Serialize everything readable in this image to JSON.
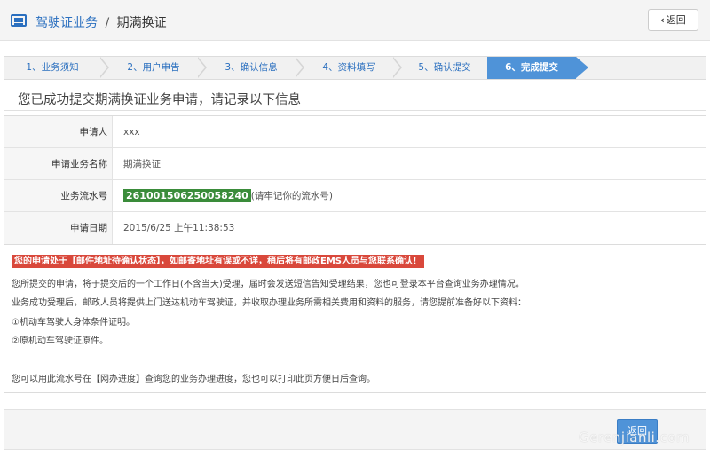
{
  "header": {
    "breadcrumb_link": "驾驶证业务",
    "breadcrumb_sep": "/",
    "breadcrumb_current": "期满换证",
    "back_label": "返回",
    "back_icon": "chevron-left-icon"
  },
  "steps": [
    {
      "label": "1、业务须知",
      "active": false
    },
    {
      "label": "2、用户申告",
      "active": false
    },
    {
      "label": "3、确认信息",
      "active": false
    },
    {
      "label": "4、资料填写",
      "active": false
    },
    {
      "label": "5、确认提交",
      "active": false
    },
    {
      "label": "6、完成提交",
      "active": true
    }
  ],
  "success_title": "您已成功提交期满换证业务申请，请记录以下信息",
  "info": [
    {
      "label": "申请人",
      "value": "xxx"
    },
    {
      "label": "申请业务名称",
      "value": "期满换证"
    },
    {
      "label": "业务流水号",
      "serial": "261001506250058240",
      "note": "(请牢记你的流水号)"
    },
    {
      "label": "申请日期",
      "value": "2015/6/25 上午11:38:53"
    }
  ],
  "notice": {
    "warning": "您的申请处于【邮件地址待确认状态】，如邮寄地址有误或不详，稍后将有邮政EMS人员与您联系确认！",
    "lines": [
      "您所提交的申请，将于提交后的一个工作日(不含当天)受理，届时会发送短信告知受理结果，您也可登录本平台查询业务办理情况。",
      "业务成功受理后，邮政人员将提供上门送达机动车驾驶证，并收取办理业务所需相关费用和资料的服务，请您提前准备好以下资料：",
      "①机动车驾驶人身体条件证明。",
      "②原机动车驾驶证原件。",
      "您可以用此流水号在【网办进度】查询您的业务办理进度，您也可以打印此页方便日后查询。"
    ]
  },
  "footer": {
    "back_label": "返回"
  },
  "watermark": "Gerenjianli.com",
  "colors": {
    "accent": "#4f93d8",
    "link": "#2a6fbf",
    "serial_bg": "#3a8c3a",
    "warning_bg": "#d9483b"
  }
}
